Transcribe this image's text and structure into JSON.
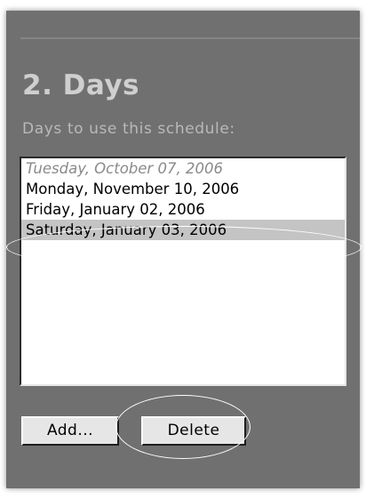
{
  "section": {
    "title": "2. Days",
    "subtitle": "Days to use this schedule:"
  },
  "days_list": {
    "items": [
      {
        "label": "Tuesday, October 07, 2006",
        "state": "dimmed"
      },
      {
        "label": "Monday, November 10, 2006",
        "state": "normal"
      },
      {
        "label": "Friday, January 02, 2006",
        "state": "normal"
      },
      {
        "label": "Saturday, January 03, 2006",
        "state": "selected"
      }
    ],
    "selected_index": 3
  },
  "buttons": {
    "add_label": "Add...",
    "delete_label": "Delete"
  },
  "colors": {
    "panel_background": "#707070",
    "title_text": "#cfcfcf",
    "selection_background": "#c4c4c4",
    "dimmed_item_text": "#8a8a8a",
    "callout_outline": "#ffffff"
  }
}
